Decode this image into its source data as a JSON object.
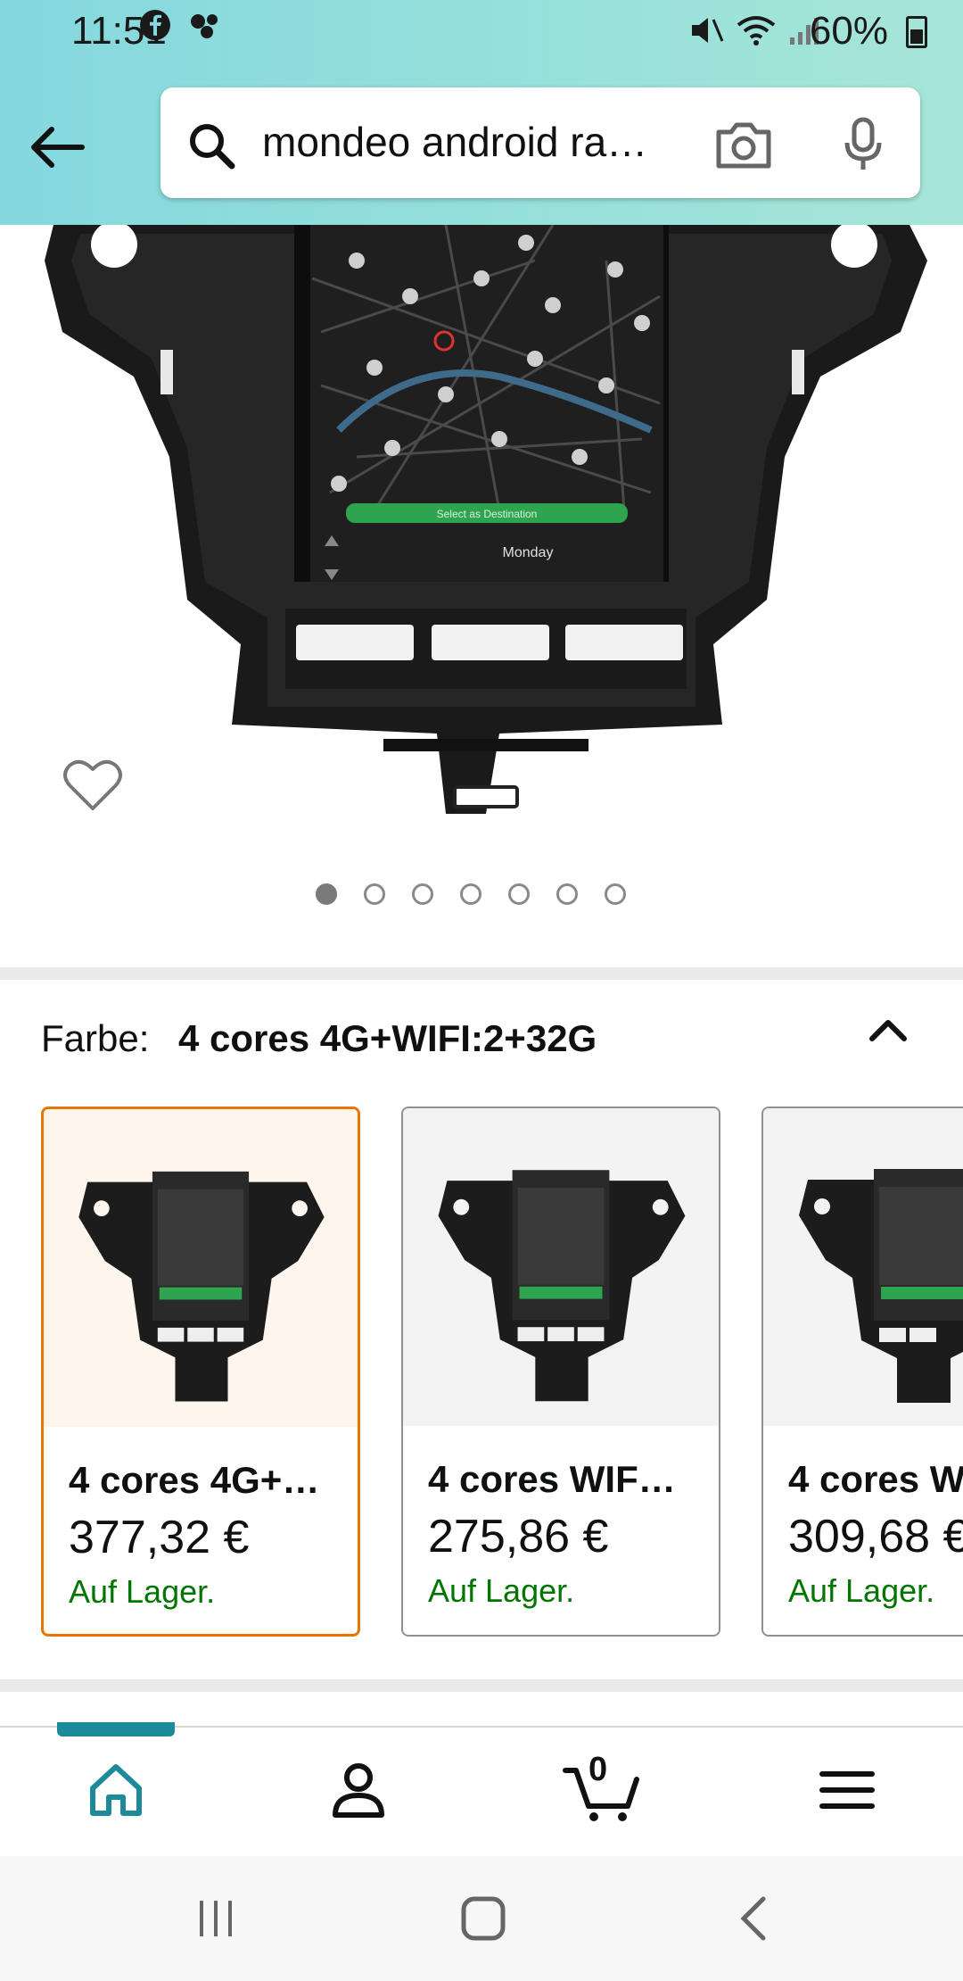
{
  "status_bar": {
    "time": "11:51",
    "battery": "60%"
  },
  "search": {
    "query": "mondeo android ra…"
  },
  "icons": {
    "back": "arrow-left-icon",
    "search": "search-icon",
    "camera": "camera-icon",
    "mic": "microphone-icon",
    "wishlist": "heart-icon",
    "collapse": "chevron-up-icon",
    "home": "home-icon",
    "account": "user-icon",
    "cart": "cart-icon",
    "menu": "hamburger-icon"
  },
  "product_image": {
    "screen_labels": {
      "button": "Select as Destination",
      "day": "Monday"
    },
    "carousel": {
      "total": 7,
      "active": 1
    }
  },
  "variant": {
    "label": "Farbe:",
    "selected": "4 cores 4G+WIFI:2+32G",
    "options": [
      {
        "name": "4 cores 4G+…",
        "price": "377,32 €",
        "stock": "Auf Lager."
      },
      {
        "name": "4 cores WIF…",
        "price": "275,86 €",
        "stock": "Auf Lager."
      },
      {
        "name": "4 cores W",
        "price": "309,68 €",
        "stock": "Auf Lager."
      }
    ]
  },
  "bottom_nav": {
    "cart_count": "0",
    "accent_color": "#1c8a99"
  },
  "colors": {
    "header_start": "#84d8de",
    "header_end": "#a6e6d8",
    "selected_border": "#e77600",
    "stock_green": "#007600"
  }
}
